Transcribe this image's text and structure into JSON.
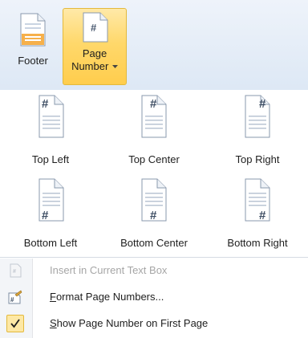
{
  "ribbon": {
    "footer": {
      "label": "Footer",
      "icon": "footer-icon"
    },
    "page_number": {
      "label_line1": "Page",
      "label_line2": "Number",
      "icon": "page-number-icon",
      "dropdown_icon": "caret-down-icon"
    }
  },
  "gallery": {
    "items": [
      {
        "label": "Top Left",
        "icon": "page-number-top-left-icon"
      },
      {
        "label": "Top Center",
        "icon": "page-number-top-center-icon"
      },
      {
        "label": "Top Right",
        "icon": "page-number-top-right-icon"
      },
      {
        "label": "Bottom Left",
        "icon": "page-number-bottom-left-icon"
      },
      {
        "label": "Bottom Center",
        "icon": "page-number-bottom-center-icon"
      },
      {
        "label": "Bottom Right",
        "icon": "page-number-bottom-right-icon"
      }
    ],
    "glyph": "#"
  },
  "menu": {
    "items": [
      {
        "pre": "",
        "accel": "",
        "post": "Insert in Current Text Box",
        "enabled": false
      },
      {
        "pre": "",
        "accel": "F",
        "post": "ormat Page Numbers...",
        "enabled": true
      },
      {
        "pre": "",
        "accel": "S",
        "post": "how Page Number on First Page",
        "enabled": true,
        "checked": true
      }
    ]
  },
  "colors": {
    "accent_hover": "#ffd86b",
    "accent_border": "#e3b93c",
    "ribbon_bg": "#dde8f5",
    "disabled_text": "#a6a6a6"
  }
}
